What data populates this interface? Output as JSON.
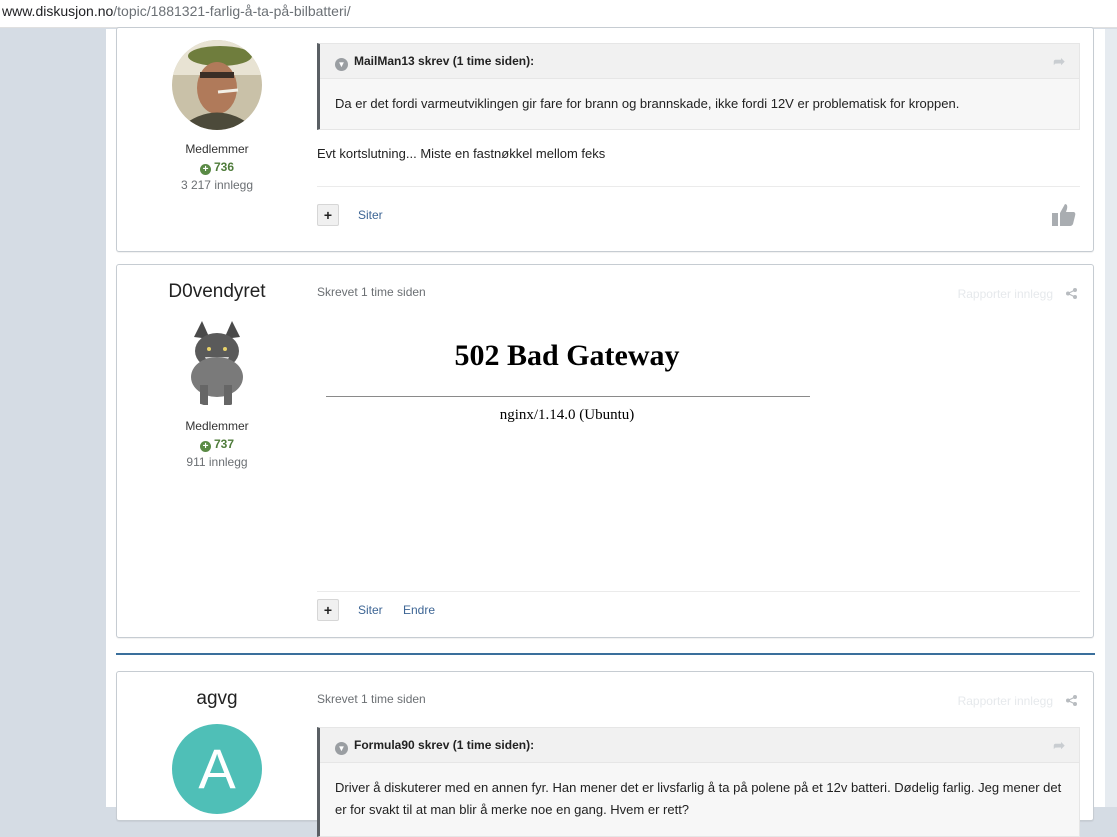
{
  "browser": {
    "url_domain": "www.diskusjon.no",
    "url_path": "/topic/1881321-farlig-å-ta-på-bilbatteri/"
  },
  "posts": [
    {
      "author": "",
      "group": "Medlemmer",
      "reputation": "736",
      "post_count": "3 217 innlegg",
      "quote": {
        "header": "MailMan13 skrev (1 time siden):",
        "text": "Da er det fordi varmeutviklingen gir fare for brann og brannskade, ikke fordi 12V er problematisk for kroppen."
      },
      "body": "Evt kortslutning... Miste en fastnøkkel mellom feks",
      "actions": [
        "Siter"
      ]
    },
    {
      "author": "D0vendyret",
      "time": "Skrevet 1 time siden",
      "report": "Rapporter innlegg",
      "group": "Medlemmer",
      "reputation": "737",
      "post_count": "911 innlegg",
      "error_title": "502 Bad Gateway",
      "error_server": "nginx/1.14.0 (Ubuntu)",
      "actions": [
        "Siter",
        "Endre"
      ]
    },
    {
      "author": "agvg",
      "avatar_letter": "A",
      "time": "Skrevet 1 time siden",
      "report": "Rapporter innlegg",
      "quote": {
        "header": "Formula90 skrev (1 time siden):",
        "text": "Driver å diskuterer med en annen fyr. Han mener det er livsfarlig å ta på polene på et 12v batteri. Dødelig farlig. Jeg mener det er for svakt til at man blir å merke noe en gang. Hvem er rett?"
      }
    }
  ],
  "icons": {
    "reputation": "plus-circle-icon",
    "quote_toggle": "chevron-down-icon",
    "quote_link": "share-arrow-icon",
    "share": "share-icon",
    "like": "thumbs-up-icon"
  },
  "colors": {
    "link": "#3d6594",
    "reputation": "#4f7c3b",
    "avatar_letter_bg": "#4fbfb7",
    "separator": "#3a6f9c"
  }
}
